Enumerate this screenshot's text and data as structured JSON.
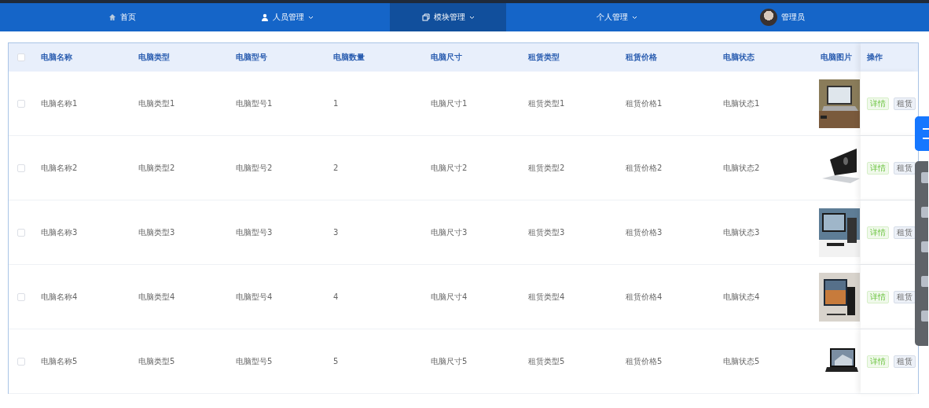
{
  "nav": {
    "items": [
      {
        "label": "首页",
        "selected": false,
        "dropdown": false
      },
      {
        "label": "人员管理",
        "selected": false,
        "dropdown": true
      },
      {
        "label": "模块管理",
        "selected": true,
        "dropdown": true
      },
      {
        "label": "个人管理",
        "selected": false,
        "dropdown": true
      }
    ],
    "user": {
      "name": "管理员"
    }
  },
  "table": {
    "header_checked": false,
    "columns": [
      "电脑名称",
      "电脑类型",
      "电脑型号",
      "电脑数量",
      "电脑尺寸",
      "租赁类型",
      "租赁价格",
      "电脑状态",
      "电脑图片",
      "操作"
    ],
    "rows": [
      {
        "checked": false,
        "cells": [
          "电脑名称1",
          "电脑类型1",
          "电脑型号1",
          "1",
          "电脑尺寸1",
          "租赁类型1",
          "租赁价格1",
          "电脑状态1"
        ],
        "actions": [
          "详情",
          "租赁"
        ]
      },
      {
        "checked": false,
        "cells": [
          "电脑名称2",
          "电脑类型2",
          "电脑型号2",
          "2",
          "电脑尺寸2",
          "租赁类型2",
          "租赁价格2",
          "电脑状态2"
        ],
        "actions": [
          "详情",
          "租赁"
        ]
      },
      {
        "checked": false,
        "cells": [
          "电脑名称3",
          "电脑类型3",
          "电脑型号3",
          "3",
          "电脑尺寸3",
          "租赁类型3",
          "租赁价格3",
          "电脑状态3"
        ],
        "actions": [
          "详情",
          "租赁"
        ]
      },
      {
        "checked": false,
        "cells": [
          "电脑名称4",
          "电脑类型4",
          "电脑型号4",
          "4",
          "电脑尺寸4",
          "租赁类型4",
          "租赁价格4",
          "电脑状态4"
        ],
        "actions": [
          "详情",
          "租赁"
        ]
      },
      {
        "checked": false,
        "cells": [
          "电脑名称5",
          "电脑类型5",
          "电脑型号5",
          "5",
          "电脑尺寸5",
          "租赁类型5",
          "租赁价格5",
          "电脑状态5"
        ],
        "actions": [
          "详情",
          "租赁"
        ]
      }
    ]
  }
}
